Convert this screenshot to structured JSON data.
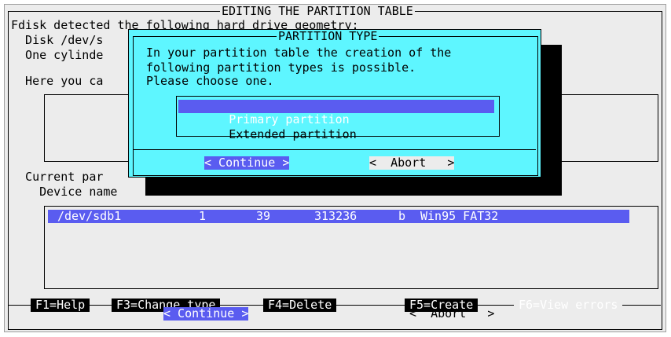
{
  "main": {
    "title": "EDITING THE PARTITION TABLE",
    "lines": [
      "Fdisk detected the following hard drive geometry:",
      "  Disk /dev/s",
      "  One cylinde",
      "",
      "  Here you ca"
    ],
    "current_part_label": "  Current par",
    "device_name_label": "    Device name"
  },
  "partition_table": {
    "rows": [
      {
        "device": "/dev/sdb1",
        "start": "1",
        "end": "39",
        "size": "313236",
        "type": "b",
        "system": "Win95 FAT32"
      }
    ]
  },
  "dialog": {
    "title": "PARTITION TYPE",
    "message": [
      "In your partition table the creation of the",
      "following partition types is possible.",
      "Please choose one."
    ],
    "options": [
      "Primary partition",
      "Extended partition"
    ],
    "selected_option": 0,
    "continue_label": "< Continue >",
    "abort_label": "<  Abort   >"
  },
  "footer": {
    "keys": [
      "F1=Help",
      "F3=Change type",
      "F4=Delete",
      "F5=Create",
      "F6=View errors"
    ],
    "continue_label": "< Continue >",
    "abort_label": "<  Abort   >"
  },
  "colors": {
    "dialog_bg": "#5ef6ff",
    "selection_bg": "#5a5cf0",
    "screen_bg": "#ececec"
  }
}
